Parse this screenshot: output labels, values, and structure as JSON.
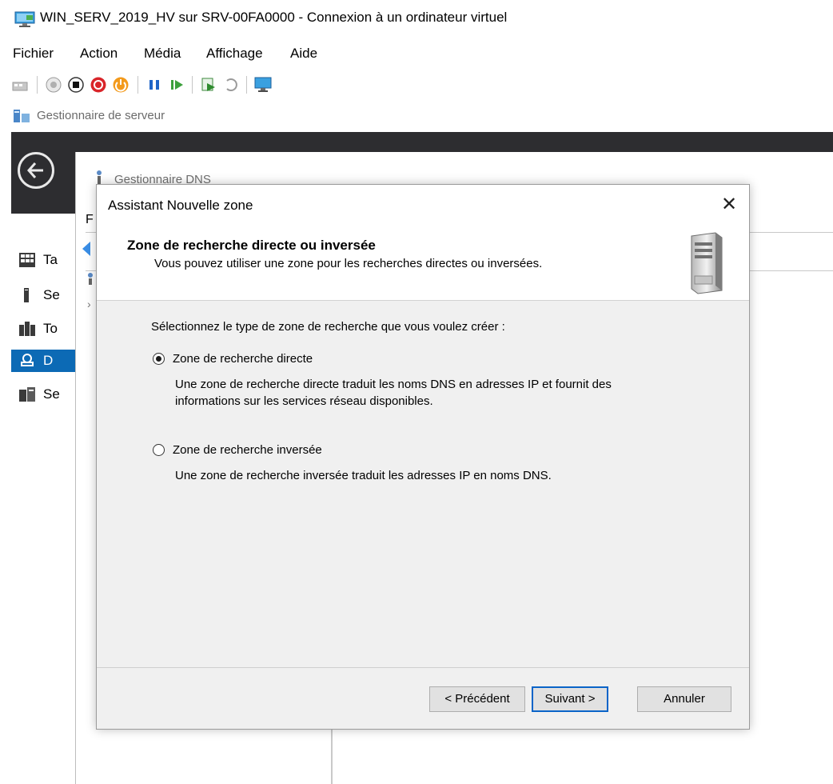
{
  "vm_window": {
    "title": "WIN_SERV_2019_HV sur SRV-00FA0000 - Connexion à un ordinateur virtuel"
  },
  "menu": {
    "items": [
      "Fichier",
      "Action",
      "Média",
      "Affichage",
      "Aide"
    ]
  },
  "toolbar": {
    "icons": [
      "ctrl-alt-del-icon",
      "start-icon",
      "turn-off-icon",
      "shutdown-icon",
      "save-icon",
      "pause-icon",
      "resume-icon",
      "checkpoint-icon",
      "revert-icon",
      "enhanced-session-icon"
    ]
  },
  "server_manager": {
    "label": "Gestionnaire de serveur",
    "sidebar": [
      {
        "label": "Ta",
        "icon": "dashboard-icon",
        "active": false
      },
      {
        "label": "Se",
        "icon": "local-server-icon",
        "active": false
      },
      {
        "label": "To",
        "icon": "all-servers-icon",
        "active": false
      },
      {
        "label": "D",
        "icon": "dns-icon",
        "active": true
      },
      {
        "label": "Se",
        "icon": "file-services-icon",
        "active": false
      }
    ]
  },
  "dns_manager": {
    "title": "Gestionnaire DNS",
    "menu_partial": "F"
  },
  "wizard": {
    "title": "Assistant Nouvelle zone",
    "close_glyph": "✕",
    "heading": "Zone de recherche directe ou inversée",
    "subheading": "Vous pouvez utiliser une zone pour les recherches directes ou inversées.",
    "prompt": "Sélectionnez le type de zone de recherche que vous voulez créer :",
    "options": [
      {
        "label": "Zone de recherche directe",
        "checked": true,
        "description_line1": "Une zone de recherche directe traduit les noms DNS en adresses IP et fournit des",
        "description_line2": "informations sur les services réseau disponibles."
      },
      {
        "label": "Zone de recherche inversée",
        "checked": false,
        "description_line1": "Une zone de recherche inversée traduit les adresses IP en noms DNS."
      }
    ],
    "buttons": {
      "back": "< Précédent",
      "next": "Suivant >",
      "cancel": "Annuler"
    }
  }
}
